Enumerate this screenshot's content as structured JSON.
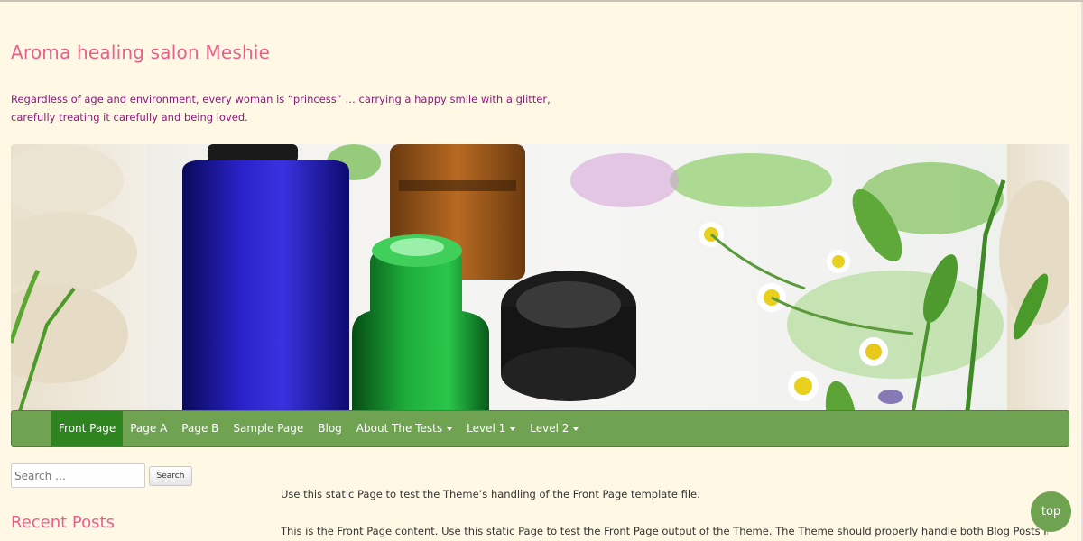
{
  "site": {
    "title": "Aroma healing salon Meshie",
    "tagline_line1": "Regardless of age and environment, every woman is “princess” … carrying a happy smile with a glitter,",
    "tagline_line2": "carefully treating it carefully and being loved."
  },
  "nav": {
    "items": [
      {
        "label": "Front Page",
        "active": true,
        "dropdown": false
      },
      {
        "label": "Page A",
        "active": false,
        "dropdown": false
      },
      {
        "label": "Page B",
        "active": false,
        "dropdown": false
      },
      {
        "label": "Sample Page",
        "active": false,
        "dropdown": false
      },
      {
        "label": "Blog",
        "active": false,
        "dropdown": false
      },
      {
        "label": "About The Tests",
        "active": false,
        "dropdown": true
      },
      {
        "label": "Level 1",
        "active": false,
        "dropdown": true
      },
      {
        "label": "Level 2",
        "active": false,
        "dropdown": true
      }
    ]
  },
  "sidebar": {
    "search_placeholder": "Search …",
    "search_button": "Search",
    "recent_posts_title": "Recent Posts"
  },
  "content": {
    "paragraph1": "Use this static Page to test the Theme’s handling of the Front Page template file.",
    "paragraph2": "This is the Front Page content. Use this static Page to test the Front Page output of the Theme. The Theme should properly handle both Blog Posts Index as"
  },
  "top_button": "top",
  "colors": {
    "background": "#fff8e5",
    "title": "#e8608a",
    "tagline": "#8a1b7a",
    "nav": "#6fa352",
    "nav_active": "#2e8520"
  }
}
